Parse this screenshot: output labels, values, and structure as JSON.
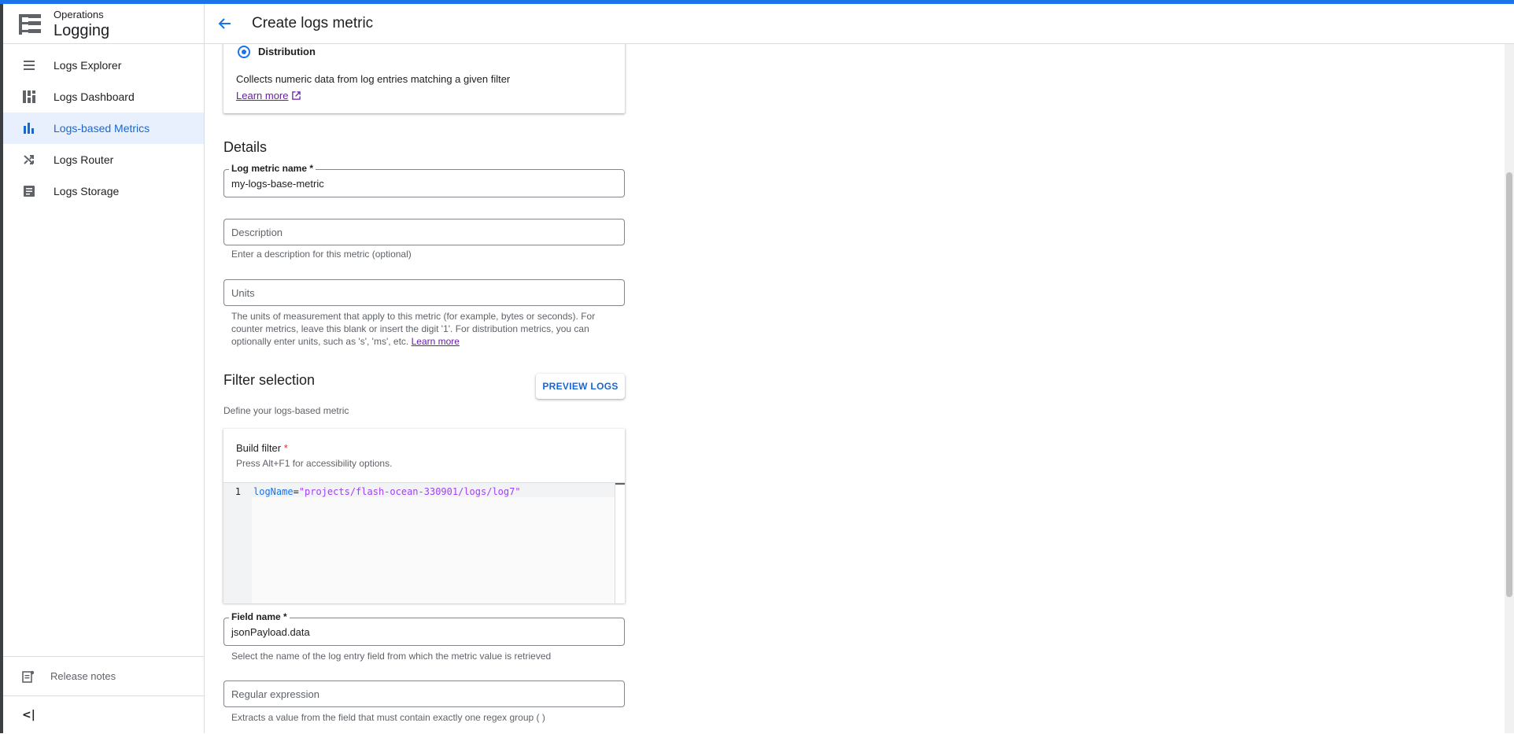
{
  "app": {
    "product_group": "Operations",
    "product_name": "Logging"
  },
  "header": {
    "title": "Create logs metric"
  },
  "sidebar": {
    "items": [
      {
        "label": "Logs Explorer",
        "icon": "list-icon",
        "active": false
      },
      {
        "label": "Logs Dashboard",
        "icon": "dashboard-icon",
        "active": false
      },
      {
        "label": "Logs-based Metrics",
        "icon": "bar-chart-icon",
        "active": true
      },
      {
        "label": "Logs Router",
        "icon": "shuffle-icon",
        "active": false
      },
      {
        "label": "Logs Storage",
        "icon": "storage-icon",
        "active": false
      }
    ],
    "release_notes": "Release notes"
  },
  "metric_type": {
    "selected": "Distribution",
    "description": "Collects numeric data from log entries matching a given filter",
    "learn_more": "Learn more"
  },
  "details": {
    "title": "Details",
    "name_label": "Log metric name *",
    "name_value": "my-logs-base-metric",
    "description_placeholder": "Description",
    "description_hint": "Enter a description for this metric (optional)",
    "units_placeholder": "Units",
    "units_hint": "The units of measurement that apply to this metric (for example, bytes or seconds). For counter metrics, leave this blank or insert the digit '1'. For distribution metrics, you can optionally enter units, such as 's', 'ms', etc.",
    "units_learn_more": "Learn more"
  },
  "filter": {
    "title": "Filter selection",
    "subtitle": "Define your logs-based metric",
    "preview_button": "PREVIEW LOGS",
    "build_label": "Build filter",
    "required_mark": "*",
    "accessibility_hint": "Press Alt+F1 for accessibility options.",
    "line_number": "1",
    "code_key": "logName",
    "code_op": "=",
    "code_value": "\"projects/flash-ocean-330901/logs/log7\""
  },
  "field": {
    "label": "Field name *",
    "value": "jsonPayload.data",
    "hint": "Select the name of the log entry field from which the metric value is retrieved",
    "regex_placeholder": "Regular expression",
    "regex_hint": "Extracts a value from the field that must contain exactly one regex group ( )"
  },
  "colors": {
    "accent": "#1a73e8",
    "active_bg": "#e8f0fe",
    "link_visited": "#681da8",
    "required": "#d93025"
  }
}
